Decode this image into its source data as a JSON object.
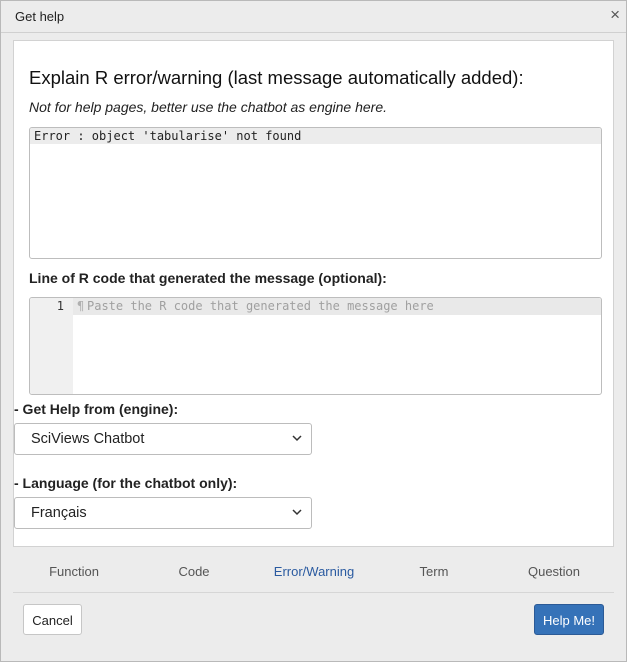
{
  "dialog": {
    "title": "Get help",
    "close_symbol": "×"
  },
  "main": {
    "heading": "Explain R error/warning (last message automatically added):",
    "subtitle": "Not for help pages, better use the chatbot as engine here.",
    "error_text": "Error : object 'tabularise' not found",
    "code_label": "Line of R code that generated the message (optional):",
    "code_line_number": "1",
    "code_pilcrow": "¶",
    "code_placeholder": "Paste the R code that generated the message here"
  },
  "engine": {
    "label": "- Get Help from (engine):",
    "selected": "SciViews Chatbot"
  },
  "language": {
    "label": "- Language (for the chatbot only):",
    "selected": "Français"
  },
  "tabs": [
    {
      "label": "Function",
      "active": false
    },
    {
      "label": "Code",
      "active": false
    },
    {
      "label": "Error/Warning",
      "active": true
    },
    {
      "label": "Term",
      "active": false
    },
    {
      "label": "Question",
      "active": false
    }
  ],
  "buttons": {
    "cancel": "Cancel",
    "help": "Help Me!"
  },
  "colors": {
    "accent": "#3572b8",
    "active_tab": "#2a5aa0"
  },
  "icons": [
    "close-icon",
    "chevron-down-icon",
    "pilcrow-icon"
  ]
}
